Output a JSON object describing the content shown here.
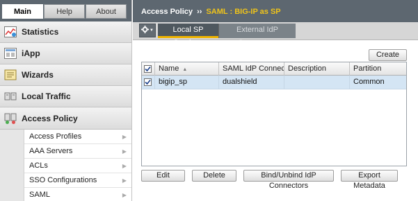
{
  "nav": {
    "tabs": [
      {
        "label": "Main"
      },
      {
        "label": "Help"
      },
      {
        "label": "About"
      }
    ],
    "sections": [
      {
        "label": "Statistics",
        "icon": "statistics-icon"
      },
      {
        "label": "iApp",
        "icon": "iapp-icon"
      },
      {
        "label": "Wizards",
        "icon": "wizards-icon"
      },
      {
        "label": "Local Traffic",
        "icon": "local-traffic-icon"
      },
      {
        "label": "Access Policy",
        "icon": "access-policy-icon"
      }
    ],
    "submenu": [
      {
        "label": "Access Profiles"
      },
      {
        "label": "AAA Servers"
      },
      {
        "label": "ACLs"
      },
      {
        "label": "SSO Configurations"
      },
      {
        "label": "SAML"
      }
    ]
  },
  "header": {
    "section": "Access Policy",
    "separator": "››",
    "current": "SAML : BIG-IP as SP"
  },
  "subtabs": {
    "active": "Local SP Services",
    "inactive": "External IdP Connectors"
  },
  "table": {
    "columns": [
      "Name",
      "SAML IdP Connectors",
      "Description",
      "Partition"
    ],
    "rows": [
      {
        "name": "bigip_sp",
        "idp_connectors": "dualshield",
        "description": "",
        "partition": "Common"
      }
    ]
  },
  "buttons": {
    "create": "Create",
    "edit": "Edit",
    "delete": "Delete",
    "bind": "Bind/Unbind IdP Connectors",
    "export": "Export Metadata"
  },
  "colors": {
    "header_bg": "#5d6770",
    "breadcrumb_accent": "#f0c419",
    "active_tab_underline": "#f0b400",
    "selected_row": "#d4e5f4"
  }
}
